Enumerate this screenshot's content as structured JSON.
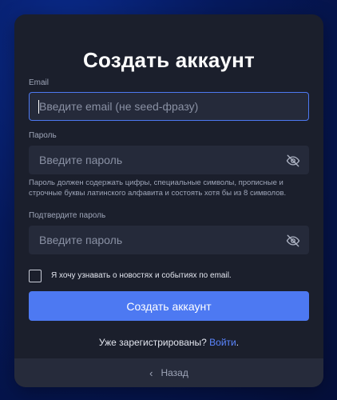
{
  "form": {
    "title": "Создать аккаунт",
    "email_label": "Email",
    "email_placeholder": "Введите email (не seed-фразу)",
    "password_label": "Пароль",
    "password_placeholder": "Введите пароль",
    "password_hint": "Пароль должен содержать цифры, специальные символы, прописные и строчные буквы латинского алфавита и состоять хотя бы из 8 символов.",
    "confirm_label": "Подтвердите пароль",
    "confirm_placeholder": "Введите пароль",
    "newsletter_label": "Я хочу узнавать о новостях и событиях по email.",
    "newsletter_checked": false,
    "submit_label": "Создать аккаунт",
    "already_registered": "Уже зарегистрированы?",
    "login_link": "Войти",
    "login_suffix": "."
  },
  "footer": {
    "back_icon": "chevron-left-icon",
    "back_label": "Назад"
  },
  "icons": {
    "password_toggle": "eye-off-icon"
  },
  "colors": {
    "accent": "#4d79f2",
    "card_bg": "#1b1f2c",
    "input_bg": "#252a3a",
    "link": "#5b86ff"
  }
}
